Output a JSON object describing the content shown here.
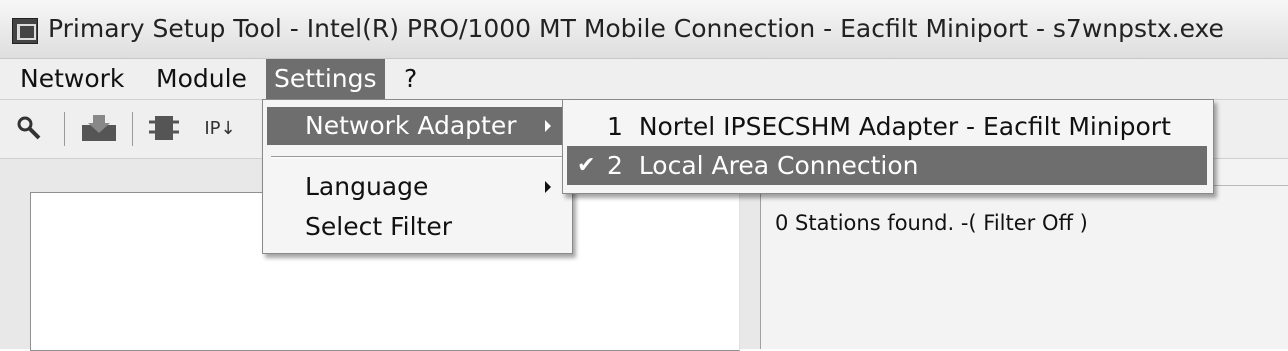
{
  "window": {
    "title": "Primary Setup Tool - Intel(R) PRO/1000 MT Mobile Connection - Eacfilt Miniport - s7wnpstx.exe",
    "icon": "app-icon"
  },
  "menubar": {
    "items": [
      {
        "label": "Network"
      },
      {
        "label": "Module"
      },
      {
        "label": "Settings",
        "active": true
      },
      {
        "label": "?"
      }
    ]
  },
  "toolbar": {
    "buttons": [
      {
        "icon": "search-icon"
      },
      {
        "icon": "download-icon"
      },
      {
        "icon": "module-icon"
      },
      {
        "icon": "ip-icon",
        "text": "IP↓"
      }
    ]
  },
  "settings_menu": {
    "items": [
      {
        "label": "Network Adapter",
        "has_submenu": true,
        "highlighted": true
      },
      {
        "label": "Language",
        "has_submenu": true
      },
      {
        "label": "Select Filter"
      }
    ]
  },
  "network_adapter_submenu": {
    "items": [
      {
        "number": "1",
        "label": "Nortel IPSECSHM Adapter - Eacfilt Miniport",
        "checked": false
      },
      {
        "number": "2",
        "label": "Local Area Connection",
        "checked": true,
        "highlighted": true
      }
    ],
    "check_glyph": "✔"
  },
  "status_panel": {
    "text": "0 Stations found. -( Filter Off )"
  },
  "colors": {
    "highlight": "#6e6e6e",
    "menubar_bg": "#efefef"
  }
}
